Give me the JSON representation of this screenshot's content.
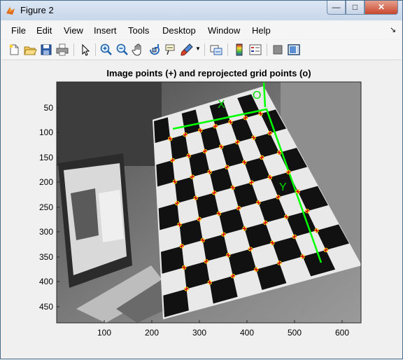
{
  "window": {
    "title": "Figure 2",
    "controls": {
      "minimize": "—",
      "maximize": "□",
      "close": "✕"
    }
  },
  "menubar": {
    "items": [
      "File",
      "Edit",
      "View",
      "Insert",
      "Tools",
      "Desktop",
      "Window",
      "Help"
    ],
    "overflow_icon": "dock-arrow-icon"
  },
  "toolbar": {
    "icons": [
      "new-figure-icon",
      "open-file-icon",
      "save-icon",
      "print-icon",
      "edit-plot-arrow-icon",
      "zoom-in-icon",
      "zoom-out-icon",
      "pan-hand-icon",
      "rotate-3d-icon",
      "data-cursor-icon",
      "brush-icon",
      "brush-dropdown-icon",
      "link-plot-icon",
      "colorbar-icon",
      "legend-icon",
      "hide-plot-tools-icon",
      "show-plot-tools-icon"
    ]
  },
  "axes": {
    "title": "Image points (+) and reprojected grid points (o)",
    "x_ticks": [
      "100",
      "200",
      "300",
      "400",
      "500",
      "600"
    ],
    "y_ticks": [
      "50",
      "100",
      "150",
      "200",
      "250",
      "300",
      "350",
      "400",
      "450"
    ],
    "annotations": {
      "origin": "O",
      "x_axis": "X",
      "y_axis": "Y"
    },
    "colors": {
      "axis_lines": "#00ff00",
      "image_points": "#ff0000",
      "reprojected": "#ffff00"
    }
  }
}
